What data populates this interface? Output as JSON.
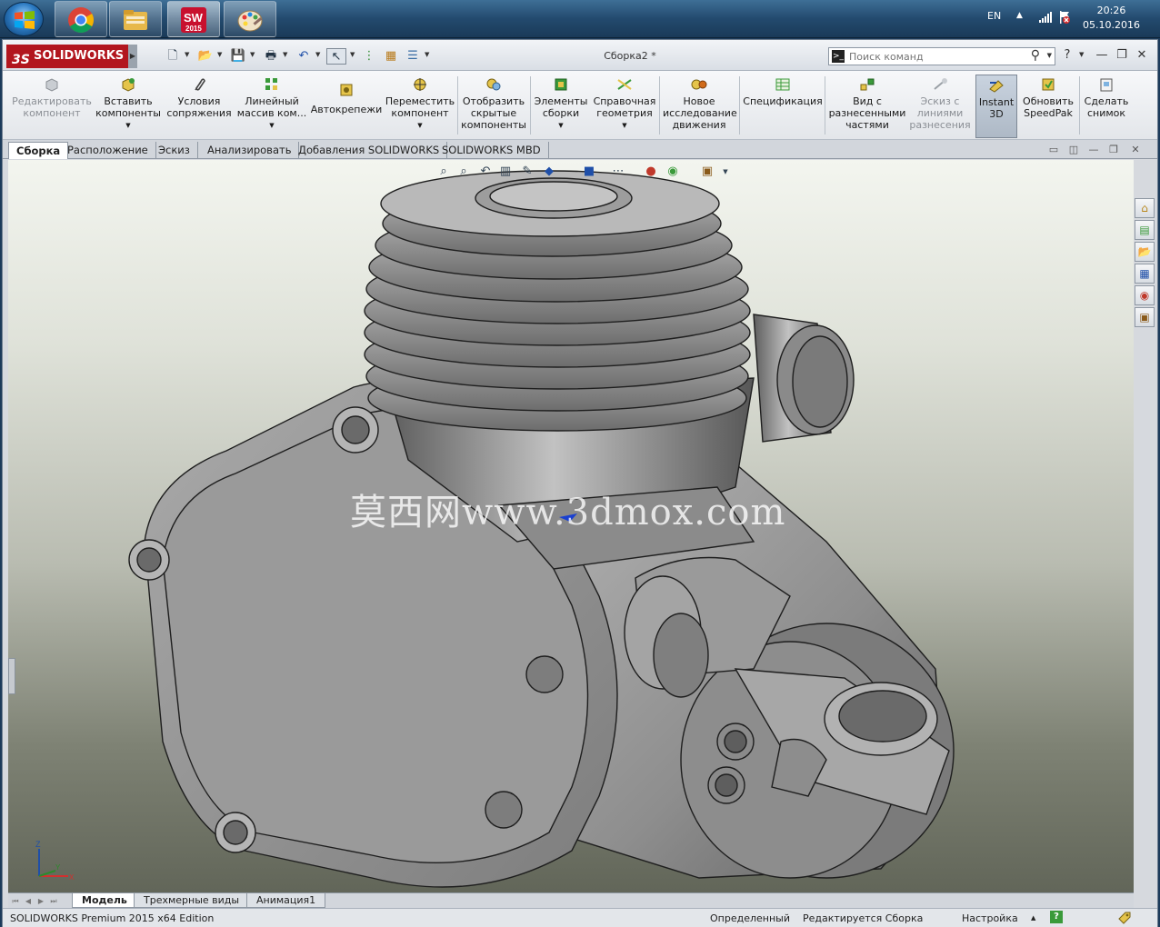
{
  "taskbar": {
    "apps": [
      {
        "name": "Google Chrome",
        "icon": "chrome-icon"
      },
      {
        "name": "Windows Explorer",
        "icon": "folder-icon"
      },
      {
        "name": "SOLIDWORKS 2015",
        "icon": "solidworks-icon",
        "label": "2015"
      },
      {
        "name": "Paint",
        "icon": "paint-icon"
      }
    ],
    "tray": {
      "language": "EN",
      "time": "20:26",
      "date": "05.10.2016"
    }
  },
  "titlebar": {
    "brand": "SOLIDWORKS",
    "brand_prefix": "3S",
    "doc_title": "Сборка2 *",
    "search_placeholder": "Поиск команд",
    "help_icon": "?",
    "minimize": "—",
    "restore": "❐",
    "close": "✕"
  },
  "ribbon": {
    "buttons": [
      {
        "label": "Редактировать компонент",
        "disabled": true,
        "dropdown": false
      },
      {
        "label": "Вставить компоненты",
        "disabled": false,
        "dropdown": true
      },
      {
        "label": "Условия сопряжения",
        "disabled": false,
        "dropdown": false
      },
      {
        "label": "Линейный массив ком...",
        "disabled": false,
        "dropdown": true
      },
      {
        "label": "Автокрепежи",
        "disabled": false,
        "dropdown": false
      },
      {
        "label": "Переместить компонент",
        "disabled": false,
        "dropdown": true
      },
      {
        "label": "Отобразить скрытые компоненты",
        "disabled": false,
        "dropdown": false
      },
      {
        "label": "Элементы сборки",
        "disabled": false,
        "dropdown": true
      },
      {
        "label": "Справочная геометрия",
        "disabled": false,
        "dropdown": true
      },
      {
        "label": "Новое исследование движения",
        "disabled": false,
        "dropdown": false
      },
      {
        "label": "Спецификация",
        "disabled": false,
        "dropdown": false
      },
      {
        "label": "Вид с разнесенными частями",
        "disabled": false,
        "dropdown": false
      },
      {
        "label": "Эскиз с линиями разнесения",
        "disabled": true,
        "dropdown": false
      },
      {
        "label": "Instant 3D",
        "disabled": false,
        "dropdown": false,
        "active": true
      },
      {
        "label": "Обновить SpeedPak",
        "disabled": false,
        "dropdown": false
      },
      {
        "label": "Сделать снимок",
        "disabled": false,
        "dropdown": false
      }
    ]
  },
  "cm_tabs": [
    "Сборка",
    "Расположение",
    "Эскиз",
    "Анализировать",
    "Добавления SOLIDWORKS",
    "SOLIDWORKS MBD"
  ],
  "viewport": {
    "watermark": "莫西网www.3dmox.com",
    "triad": {
      "z": "Z",
      "y": "Y",
      "x": "X"
    },
    "colors": {
      "model": "#9a9a9a",
      "edge": "#1e1e1e"
    }
  },
  "bottom_tabs": [
    "Модель",
    "Трехмерные виды",
    "Анимация1"
  ],
  "statusbar": {
    "edition": "SOLIDWORKS Premium 2015 x64 Edition",
    "state": "Определенный",
    "editing": "Редактируется Сборка",
    "settings": "Настройка",
    "settings_arrow": "▲",
    "help": "?"
  }
}
